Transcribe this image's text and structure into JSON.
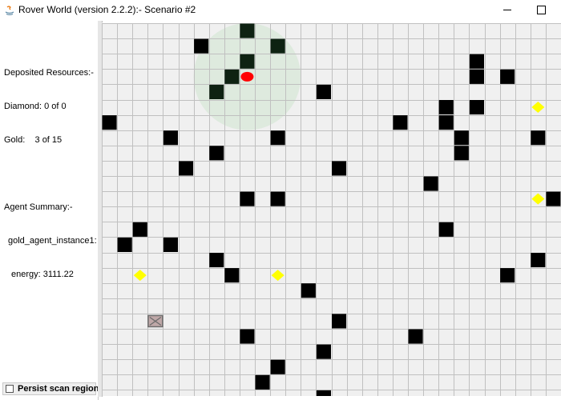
{
  "window": {
    "title": "Rover World (version 2.2.2):- Scenario #2",
    "icons": [
      "java-icon",
      "minimize-icon",
      "maximize-icon"
    ]
  },
  "info_panel": {
    "deposited_header": "Deposited Resources:-",
    "diamond": "Diamond: 0 of 0",
    "gold": "Gold:    3 of 15",
    "agent_header": "Agent Summary:-",
    "agent_name": "gold_agent_instance1:",
    "energy": "energy: 3111.22"
  },
  "persist": {
    "label": "Persist scan region",
    "checked": false
  },
  "grid": {
    "columns": 30,
    "rows": 24,
    "colors": {
      "background": "#f0f0f0",
      "grid_line": "#c0c0c0",
      "obstacle": "#000000",
      "obstacle_scanned": "#0e2212",
      "gold": "#ffff00",
      "agent": "#ff0000",
      "scan_region": "#cfe6cf",
      "base_fill": "#bfa8a8",
      "base_stroke": "#6b6b6b"
    },
    "scan_region": {
      "col": 9.5,
      "row": 3.5,
      "radius_cells": 3.5
    },
    "agent": {
      "col": 9.5,
      "row": 3.5
    },
    "base": {
      "col": 3.5,
      "row": 19.5
    },
    "obstacles": [
      [
        9,
        0
      ],
      [
        6,
        1
      ],
      [
        11,
        1
      ],
      [
        9,
        2
      ],
      [
        24,
        2
      ],
      [
        8,
        3
      ],
      [
        24,
        3
      ],
      [
        26,
        3
      ],
      [
        7,
        4
      ],
      [
        14,
        4
      ],
      [
        22,
        5
      ],
      [
        24,
        5
      ],
      [
        0,
        6
      ],
      [
        19,
        6
      ],
      [
        22,
        6
      ],
      [
        4,
        7
      ],
      [
        11,
        7
      ],
      [
        23,
        7
      ],
      [
        28,
        7
      ],
      [
        7,
        8
      ],
      [
        23,
        8
      ],
      [
        5,
        9
      ],
      [
        15,
        9
      ],
      [
        21,
        10
      ],
      [
        9,
        11
      ],
      [
        11,
        11
      ],
      [
        29,
        11
      ],
      [
        2,
        13
      ],
      [
        22,
        13
      ],
      [
        1,
        14
      ],
      [
        4,
        14
      ],
      [
        7,
        15
      ],
      [
        28,
        15
      ],
      [
        8,
        16
      ],
      [
        26,
        16
      ],
      [
        13,
        17
      ],
      [
        15,
        19
      ],
      [
        9,
        20
      ],
      [
        20,
        20
      ],
      [
        14,
        21
      ],
      [
        11,
        22
      ],
      [
        10,
        23
      ],
      [
        14,
        24
      ]
    ],
    "gold": [
      [
        28,
        5
      ],
      [
        28,
        11
      ],
      [
        2,
        16
      ],
      [
        11,
        16
      ]
    ]
  }
}
